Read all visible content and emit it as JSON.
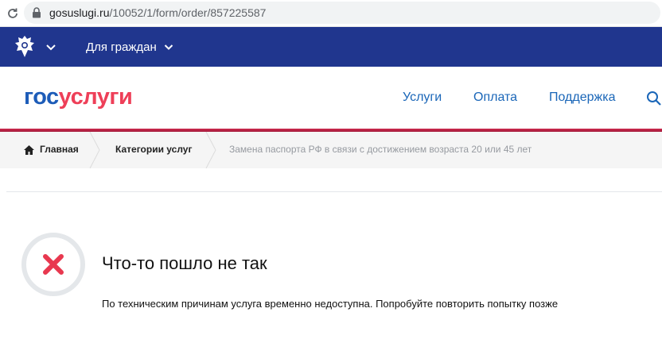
{
  "browser": {
    "url_host": "gosuslugi.ru",
    "url_path": "/10052/1/form/order/857225587"
  },
  "govbar": {
    "citizens_label": "Для граждан"
  },
  "header": {
    "logo_part1": "гос",
    "logo_part2": "услуги",
    "nav": [
      {
        "label": "Услуги"
      },
      {
        "label": "Оплата"
      },
      {
        "label": "Поддержка"
      }
    ]
  },
  "breadcrumb": {
    "home_label": "Главная",
    "categories_label": "Категории услуг",
    "current_label": "Замена паспорта РФ в связи с достижением возраста 20 или 45 лет"
  },
  "error": {
    "title": "Что-то пошло не так",
    "message": "По техническим причинам услуга временно недоступна. Попробуйте повторить попытку позже"
  },
  "colors": {
    "gov_navy": "#20368e",
    "logo_blue": "#1d5cb8",
    "logo_red": "#ee3f58",
    "nav_blue": "#1a66b8",
    "accent_line": "#b51f45",
    "error_red": "#e8384f"
  }
}
